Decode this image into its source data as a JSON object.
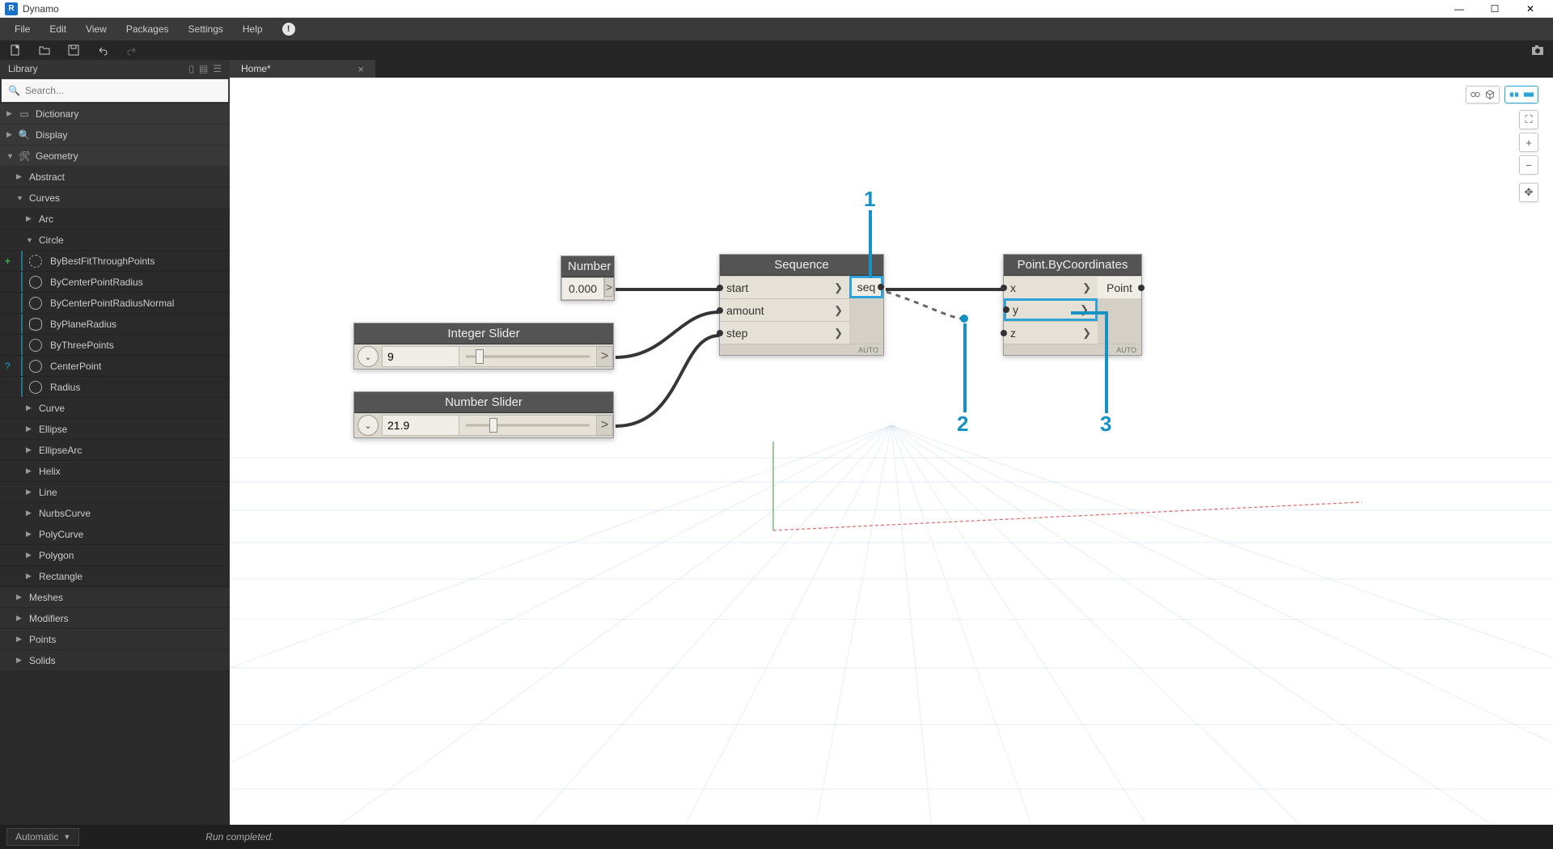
{
  "window": {
    "title": "Dynamo",
    "app_icon_letter": "R"
  },
  "menu": {
    "items": [
      "File",
      "Edit",
      "View",
      "Packages",
      "Settings",
      "Help"
    ]
  },
  "tab": {
    "label": "Home*",
    "close": "×"
  },
  "library": {
    "title": "Library",
    "search_placeholder": "Search...",
    "top": [
      {
        "label": "Dictionary",
        "icon": "dict"
      },
      {
        "label": "Display",
        "icon": "search"
      },
      {
        "label": "Geometry",
        "icon": "wrench",
        "expanded": true
      }
    ],
    "geometry_children": [
      {
        "label": "Abstract",
        "level": 1
      },
      {
        "label": "Curves",
        "level": 1,
        "expanded": true,
        "children": [
          {
            "label": "Arc",
            "level": 2
          },
          {
            "label": "Circle",
            "level": 2,
            "expanded": true,
            "children": [
              {
                "label": "ByBestFitThroughPoints",
                "marker": "plus"
              },
              {
                "label": "ByCenterPointRadius"
              },
              {
                "label": "ByCenterPointRadiusNormal"
              },
              {
                "label": "ByPlaneRadius"
              },
              {
                "label": "ByThreePoints"
              },
              {
                "label": "CenterPoint",
                "marker": "query"
              },
              {
                "label": "Radius"
              }
            ]
          },
          {
            "label": "Curve",
            "level": 2
          },
          {
            "label": "Ellipse",
            "level": 2
          },
          {
            "label": "EllipseArc",
            "level": 2
          },
          {
            "label": "Helix",
            "level": 2
          },
          {
            "label": "Line",
            "level": 2
          },
          {
            "label": "NurbsCurve",
            "level": 2
          },
          {
            "label": "PolyCurve",
            "level": 2
          },
          {
            "label": "Polygon",
            "level": 2
          },
          {
            "label": "Rectangle",
            "level": 2
          }
        ]
      },
      {
        "label": "Meshes",
        "level": 1
      },
      {
        "label": "Modifiers",
        "level": 1
      },
      {
        "label": "Points",
        "level": 1
      },
      {
        "label": "Solids",
        "level": 1
      }
    ]
  },
  "nodes": {
    "number": {
      "title": "Number",
      "value": "0.000",
      "expand": ">"
    },
    "int_slider": {
      "title": "Integer Slider",
      "value": "9",
      "thumb_pct": 15
    },
    "num_slider": {
      "title": "Number Slider",
      "value": "21.9",
      "thumb_pct": 25
    },
    "sequence": {
      "title": "Sequence",
      "inputs": [
        "start",
        "amount",
        "step"
      ],
      "output": "seq",
      "auto": "AUTO"
    },
    "point": {
      "title": "Point.ByCoordinates",
      "inputs": [
        "x",
        "y",
        "z"
      ],
      "output": "Point",
      "auto": "AUTO"
    }
  },
  "callouts": {
    "c1": "1",
    "c2": "2",
    "c3": "3"
  },
  "status": {
    "run_mode": "Automatic",
    "message": "Run completed."
  }
}
